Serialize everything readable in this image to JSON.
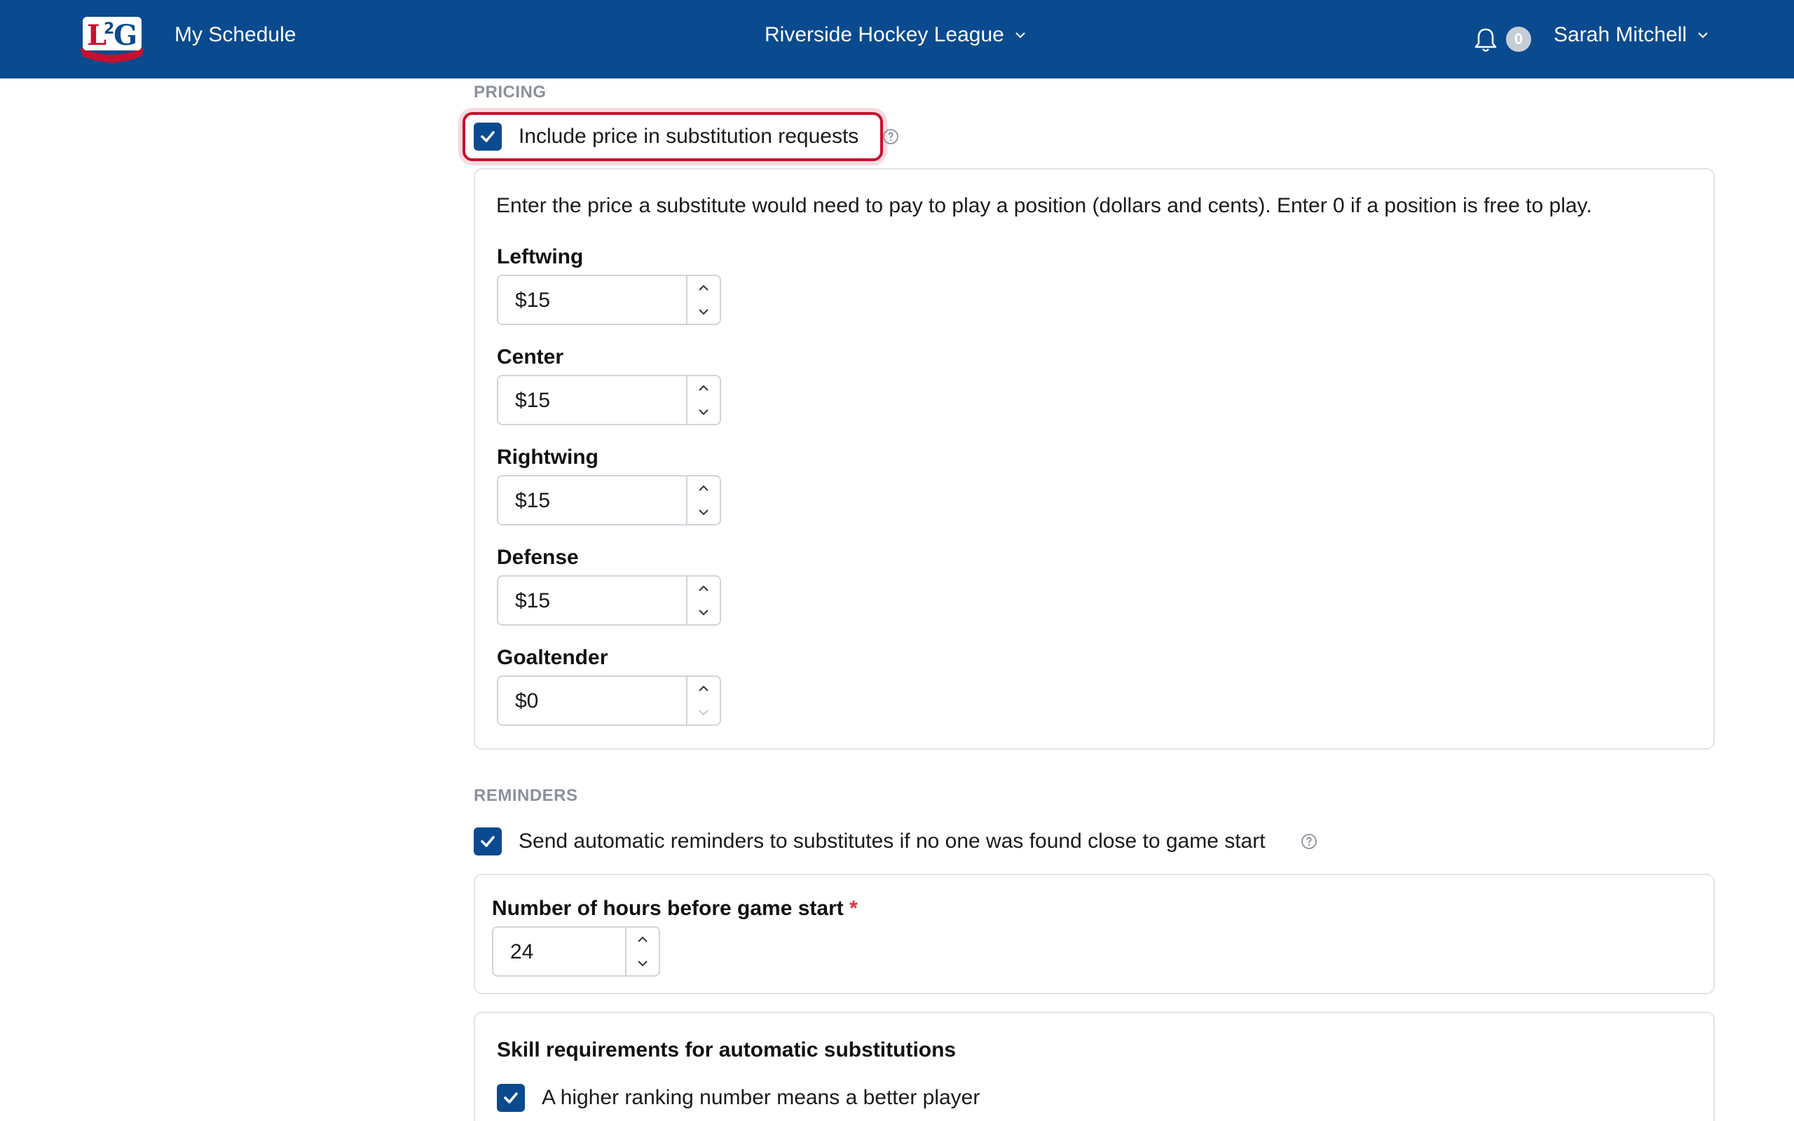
{
  "header": {
    "nav_schedule": "My Schedule",
    "league_name": "Riverside Hockey League",
    "notification_count": "0",
    "user_name": "Sarah Mitchell",
    "brand_color": "#0a4a8f"
  },
  "pricing": {
    "section_title": "PRICING",
    "include_price_label": "Include price in substitution requests",
    "include_price_checked": true,
    "description": "Enter the price a substitute would need to pay to play a position (dollars and cents). Enter 0 if a position is free to play.",
    "positions": [
      {
        "label": "Leftwing",
        "value": "$15"
      },
      {
        "label": "Center",
        "value": "$15"
      },
      {
        "label": "Rightwing",
        "value": "$15"
      },
      {
        "label": "Defense",
        "value": "$15"
      },
      {
        "label": "Goaltender",
        "value": "$0"
      }
    ]
  },
  "reminders": {
    "section_title": "REMINDERS",
    "auto_reminder_label": "Send automatic reminders to substitutes if no one was found close to game start",
    "auto_reminder_checked": true,
    "hours_label": "Number of hours before game start",
    "required_mark": "*",
    "hours_value": "24"
  },
  "skills": {
    "title": "Skill requirements for automatic substitutions",
    "ranking_label": "A higher ranking number means a better player",
    "ranking_checked": true
  }
}
